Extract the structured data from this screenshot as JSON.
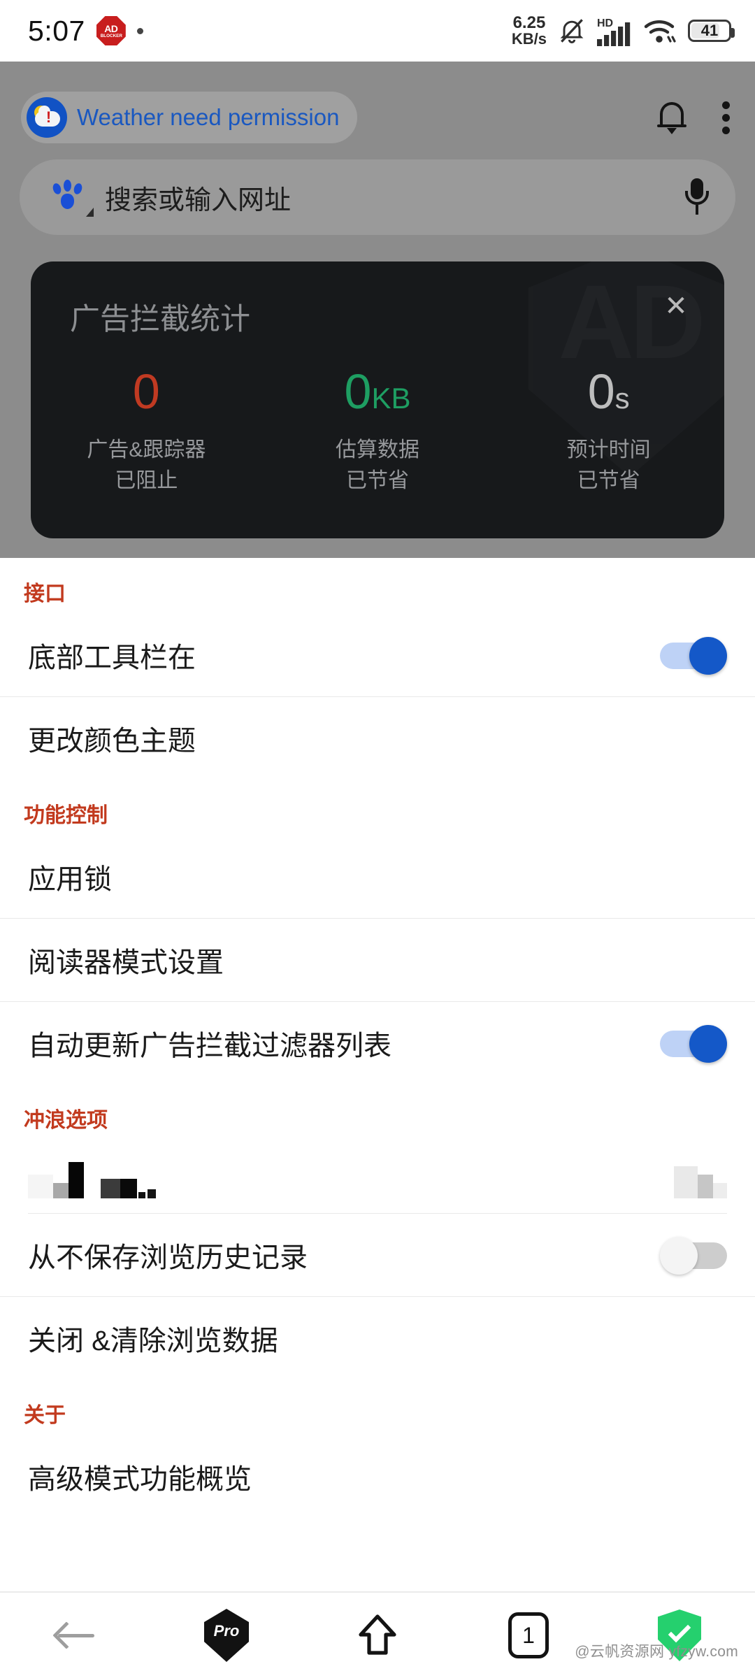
{
  "status_bar": {
    "time": "5:07",
    "app_badge": {
      "line1": "AD",
      "line2": "BLOCKER",
      "name": "ad-blocker-badge"
    },
    "net_speed_value": "6.25",
    "net_speed_unit": "KB/s",
    "icons": [
      "bell-muted-icon",
      "hd-signal-icon",
      "wifi-icon"
    ],
    "battery_percent": "41"
  },
  "browser_top": {
    "weather_notice": "Weather need permission",
    "weather_icon": "weather-warning-icon",
    "bell_icon": "notification-bell-icon",
    "menu_icon": "kebab-menu-icon",
    "search_placeholder": "搜索或输入网址",
    "search_engine_icon": "baidu-paw-icon",
    "mic_icon": "microphone-icon"
  },
  "stats_card": {
    "title": "广告拦截统计",
    "close_icon": "close-icon",
    "close_label": "✕",
    "watermark_text": "AD",
    "colors": {
      "blocked": "#C03A22",
      "data": "#1E9E62",
      "time": "#BDBDBD",
      "card_bg": "#17191B"
    },
    "items": [
      {
        "value": "0",
        "unit": "",
        "label_line1": "广告&跟踪器",
        "label_line2": "已阻止",
        "color": "#C03A22"
      },
      {
        "value": "0",
        "unit": "KB",
        "label_line1": "估算数据",
        "label_line2": "已节省",
        "color": "#1E9E62"
      },
      {
        "value": "0",
        "unit": "s",
        "label_line1": "预计时间",
        "label_line2": "已节省",
        "color": "#BDBDBD"
      }
    ]
  },
  "settings": {
    "accent_color": "#C23A1E",
    "sections": [
      {
        "header": "接口",
        "rows": [
          {
            "label": "底部工具栏在",
            "type": "toggle",
            "state": "on"
          },
          {
            "label": "更改颜色主题",
            "type": "link"
          }
        ]
      },
      {
        "header": "功能控制",
        "rows": [
          {
            "label": "应用锁",
            "type": "link"
          },
          {
            "label": "阅读器模式设置",
            "type": "link"
          },
          {
            "label": "自动更新广告拦截过滤器列表",
            "type": "toggle",
            "state": "on"
          }
        ]
      },
      {
        "header": "冲浪选项",
        "rows": [
          {
            "label": "",
            "type": "censored",
            "state": "censored"
          },
          {
            "label": "从不保存浏览历史记录",
            "type": "toggle",
            "state": "off"
          },
          {
            "label": "关闭 &清除浏览数据",
            "type": "link"
          }
        ]
      },
      {
        "header": "关于",
        "rows": [
          {
            "label": "高级模式功能概览",
            "type": "link"
          }
        ]
      }
    ]
  },
  "bottom_nav": {
    "items": [
      {
        "name": "back-button",
        "icon": "arrow-left-icon",
        "label": ""
      },
      {
        "name": "pro-button",
        "icon": "pro-shield-icon",
        "label": "Pro"
      },
      {
        "name": "home-button",
        "icon": "home-icon",
        "label": ""
      },
      {
        "name": "tabs-button",
        "icon": "tab-count-icon",
        "label": "1"
      },
      {
        "name": "shield-button",
        "icon": "shield-check-icon",
        "label": ""
      }
    ]
  },
  "watermark": "@云帆资源网 yfzyw.com"
}
